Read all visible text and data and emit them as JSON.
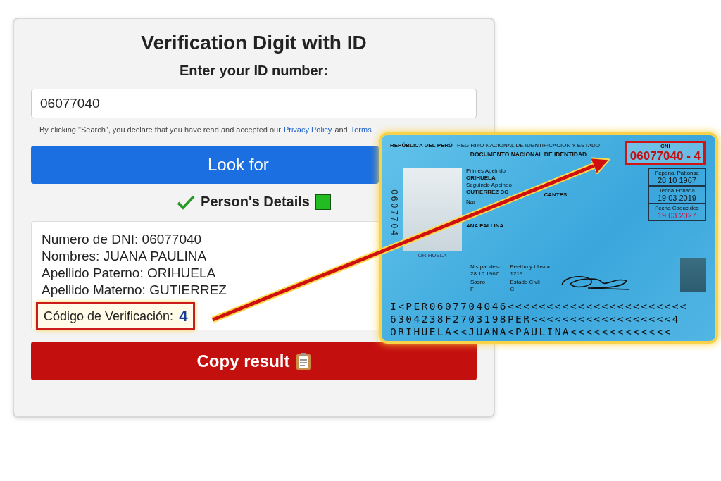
{
  "form": {
    "title": "Verification Digit with ID",
    "prompt": "Enter your ID number:",
    "id_value": "06077040",
    "disclaimer": {
      "text": "By clicking \"Search\", you declare that you have read and accepted our",
      "privacy_link": "Privacy Policy",
      "joiner": "and",
      "terms_link": "Terms"
    },
    "search_button": "Look for",
    "details_heading": "Person's Details",
    "details": [
      {
        "label": "Numero de DNI:",
        "value": "06077040"
      },
      {
        "label": "Nombres:",
        "value": "JUANA PAULINA"
      },
      {
        "label": "Apellido Paterno:",
        "value": "ORIHUELA"
      },
      {
        "label": "Apellido Materno:",
        "value": "GUTIERREZ"
      }
    ],
    "code": {
      "label": "Código de Verificación:",
      "value": "4"
    },
    "copy_button": "Copy result"
  },
  "id_card": {
    "country": "REPÚBLICA DEL PERÚ",
    "registry": "REGIRITO NACIONAL DE IDENTIFICACION Y ESTADO",
    "doc_type": "DOCUMENTO NACIONAL DE IDENTIDAD",
    "cni_label": "CNI",
    "cni_value": "06077040 - 4",
    "side_number": "0607704",
    "photo_caption": "ORIHUELA",
    "fields": [
      {
        "label": "Primes Apeindo",
        "value": "ORIHUELA"
      },
      {
        "label": "Seguindo Apeindo",
        "value": "GUTIERREZ DO",
        "value_tail": "CANTES"
      },
      {
        "label": "Nar",
        "value": "ANA PALLINA"
      }
    ],
    "small_fields": [
      {
        "label": "Nis pandeso",
        "value": "28 10 1967"
      },
      {
        "label": "Peetho y Uhsca",
        "value": "1219"
      },
      {
        "label": "Sasro",
        "value": "F"
      },
      {
        "label": "Estado Civil",
        "value": "C"
      }
    ],
    "date_boxes": [
      {
        "label": "Peponal Pattonse",
        "value": "28 10 1967",
        "expired": false
      },
      {
        "label": "Techa Ennada",
        "value": "19 03 2019",
        "expired": false
      },
      {
        "label": "Fecha Caducides",
        "value": "19 03 2027",
        "expired": true
      }
    ],
    "mrz": [
      "I<PER0607704046<<<<<<<<<<<<<<<<<<<<<<<",
      "6304238F2703198PER<<<<<<<<<<<<<<<<<<4",
      "ORIHUELA<<JUANA<PAULINA<<<<<<<<<<<<<"
    ]
  }
}
